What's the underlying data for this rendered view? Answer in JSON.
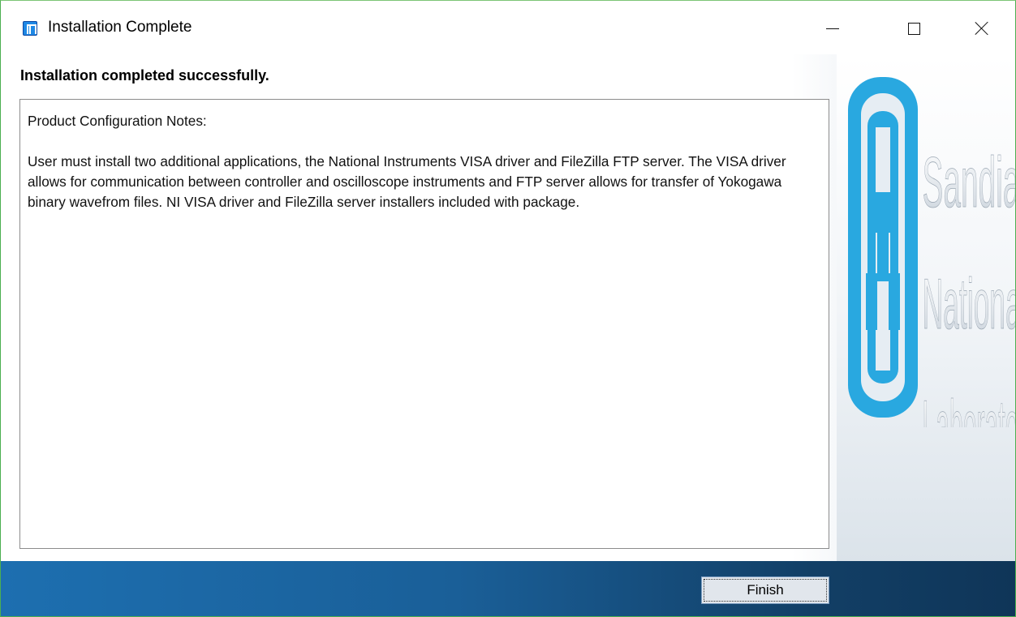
{
  "window": {
    "title": "Installation Complete"
  },
  "content": {
    "heading": "Installation completed successfully.",
    "notes_title": "Product Configuration Notes:",
    "notes_body": "User must install two additional applications, the National Instruments VISA driver and FileZilla FTP server. The VISA driver allows for communication between controller and oscilloscope instruments and FTP server allows for transfer of Yokogawa binary wavefrom files. NI VISA driver and FileZilla server installers included with package."
  },
  "logo": {
    "line1": "Sandia",
    "line2": "National",
    "line3": "Laboratories"
  },
  "footer": {
    "finish_label": "Finish"
  },
  "colors": {
    "accent": "#29a8e0",
    "footer_start": "#1d6fb0",
    "footer_end": "#0f3558"
  },
  "icons": {
    "app": "sandia-app-icon",
    "minimize": "minimize-icon",
    "maximize": "maximize-icon",
    "close": "close-icon"
  }
}
